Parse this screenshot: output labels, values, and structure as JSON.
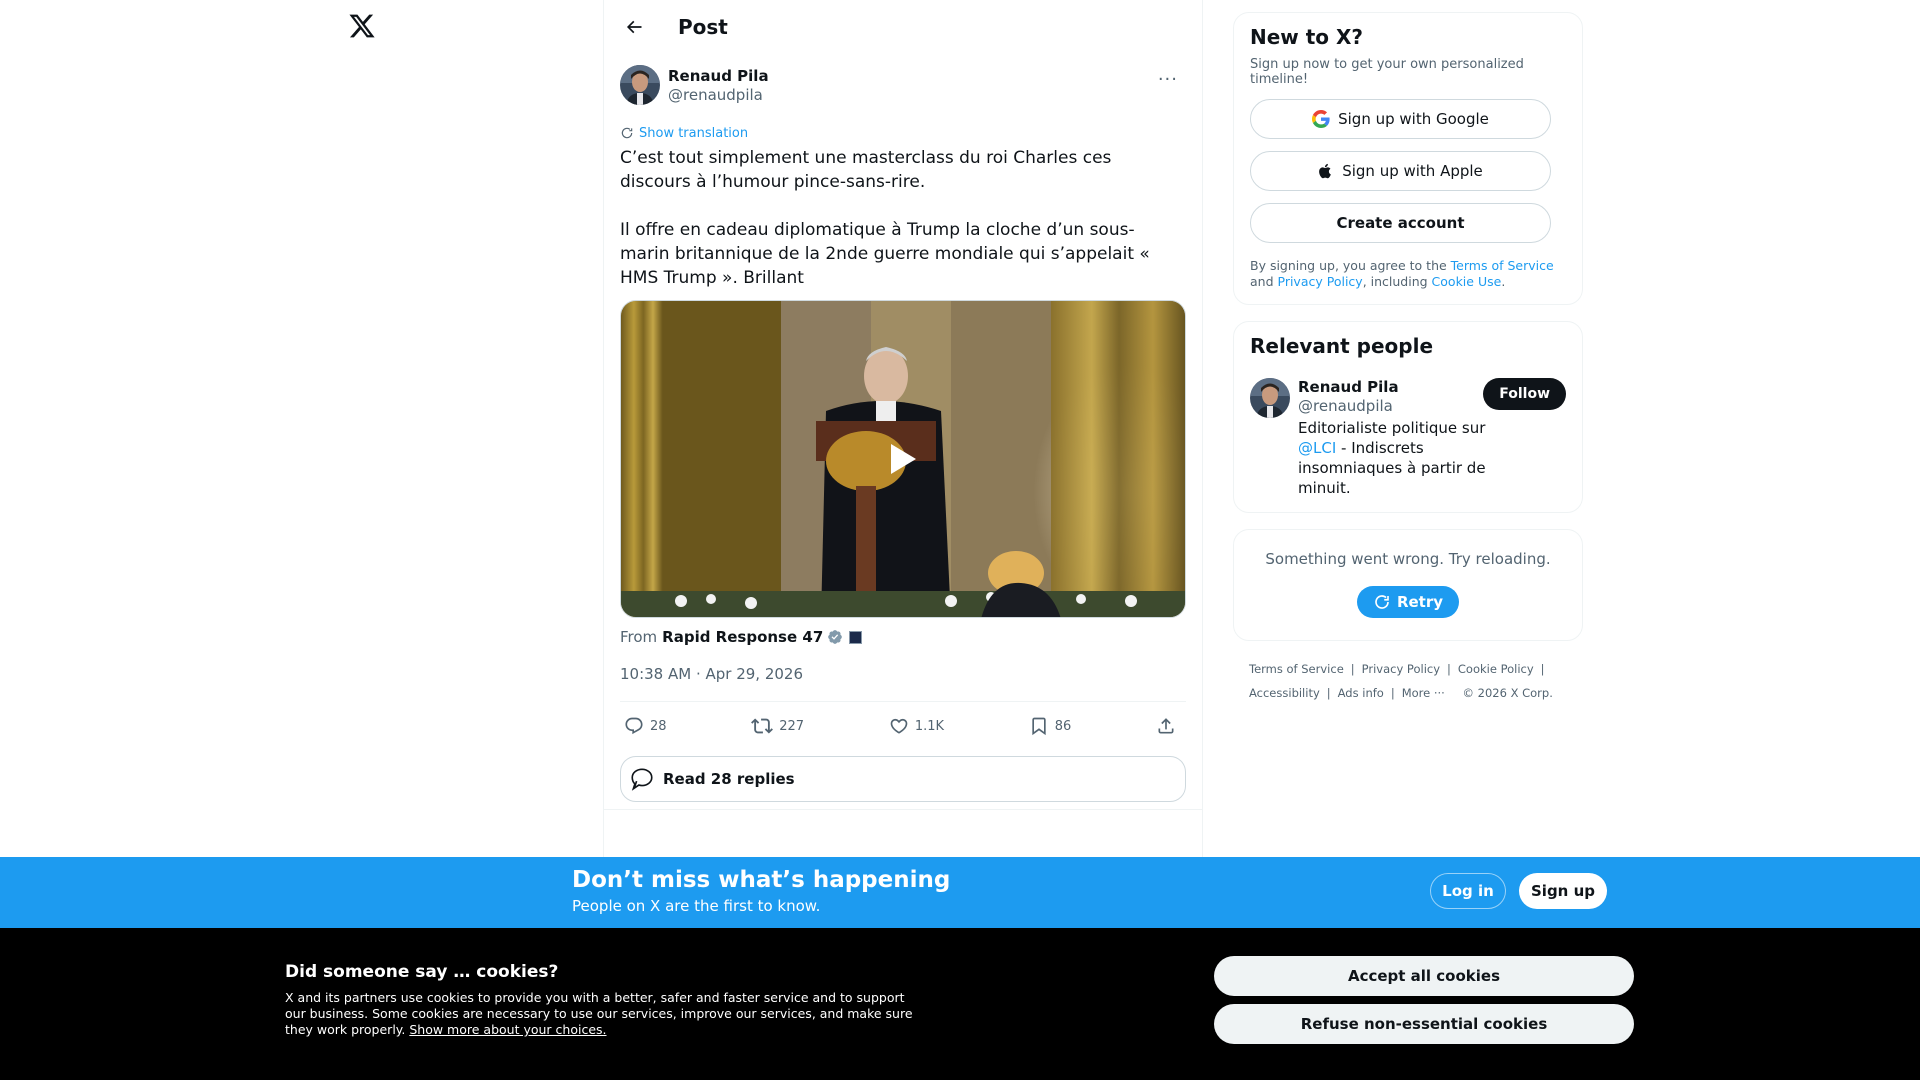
{
  "header": {
    "title": "Post"
  },
  "post": {
    "author_name": "Renaud Pila",
    "author_handle": "@renaudpila",
    "translate_label": "Show translation",
    "text": "C’est tout simplement une masterclass du roi Charles ces discours à l’humour pince-sans-rire.\n\nIl offre en cadeau diplomatique à Trump la cloche d’un sous-marin britannique de la 2nde guerre mondiale qui s’appelait « HMS Trump ». Brillant",
    "source_prefix": "From",
    "source_name": "Rapid Response 47",
    "timestamp": "10:38 AM · Apr 29, 2026",
    "replies": "28",
    "reposts": "227",
    "likes": "1.1K",
    "bookmarks": "86",
    "read_replies_label": "Read 28 replies"
  },
  "new_to_x": {
    "title": "New to X?",
    "subtitle": "Sign up now to get your own personalized timeline!",
    "google_label": "Sign up with Google",
    "apple_label": "Sign up with Apple",
    "create_label": "Create account",
    "legal_prefix": "By signing up, you agree to the ",
    "terms_link": "Terms of Service",
    "legal_and": " and ",
    "privacy_link": "Privacy Policy",
    "legal_including": ", including ",
    "cookie_link": "Cookie Use",
    "legal_end": "."
  },
  "relevant_people": {
    "title": "Relevant people",
    "name": "Renaud Pila",
    "handle": "@renaudpila",
    "follow_label": "Follow",
    "bio_prefix": "Editorialiste politique sur ",
    "bio_mention": "@LCI",
    "bio_suffix": " - Indiscrets insomniaques à partir de minuit."
  },
  "error_card": {
    "message": "Something went wrong. Try reloading.",
    "retry_label": "Retry"
  },
  "footer": {
    "terms": "Terms of Service",
    "privacy": "Privacy Policy",
    "cookie": "Cookie Policy",
    "accessibility": "Accessibility",
    "ads": "Ads info",
    "more": "More ···",
    "copyright": "© 2026 X Corp."
  },
  "signup_bar": {
    "title": "Don’t miss what’s happening",
    "subtitle": "People on X are the first to know.",
    "login_label": "Log in",
    "signup_label": "Sign up"
  },
  "cookie_bar": {
    "title": "Did someone say … cookies?",
    "text": "X and its partners use cookies to provide you with a better, safer and faster service and to support our business. Some cookies are necessary to use our services, improve our services, and make sure they work properly. ",
    "link": "Show more about your choices.",
    "accept_label": "Accept all cookies",
    "refuse_label": "Refuse non-essential cookies"
  },
  "colors": {
    "accent": "#1d9bf0",
    "text": "#0f1419",
    "muted": "#536471"
  }
}
